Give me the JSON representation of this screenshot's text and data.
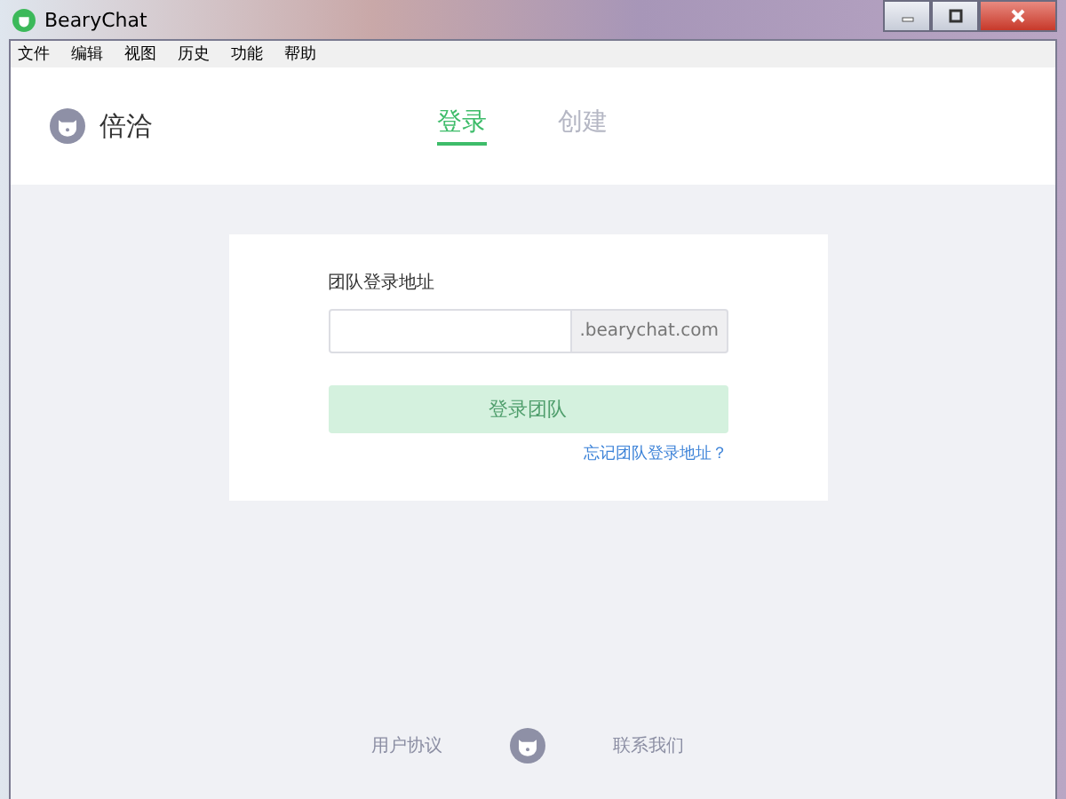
{
  "window": {
    "title": "BearyChat"
  },
  "menu": [
    "文件",
    "编辑",
    "视图",
    "历史",
    "功能",
    "帮助"
  ],
  "brand": {
    "name": "倍洽"
  },
  "tabs": [
    {
      "label": "登录",
      "selected": true
    },
    {
      "label": "创建",
      "selected": false
    }
  ],
  "form": {
    "label": "团队登录地址",
    "suffix": ".bearychat.com",
    "submit": {
      "label": "登录团队",
      "disabled": true
    },
    "forgot_link": "忘记团队登录地址？"
  },
  "footer": {
    "links": [
      "用户协议",
      "联系我们"
    ]
  }
}
